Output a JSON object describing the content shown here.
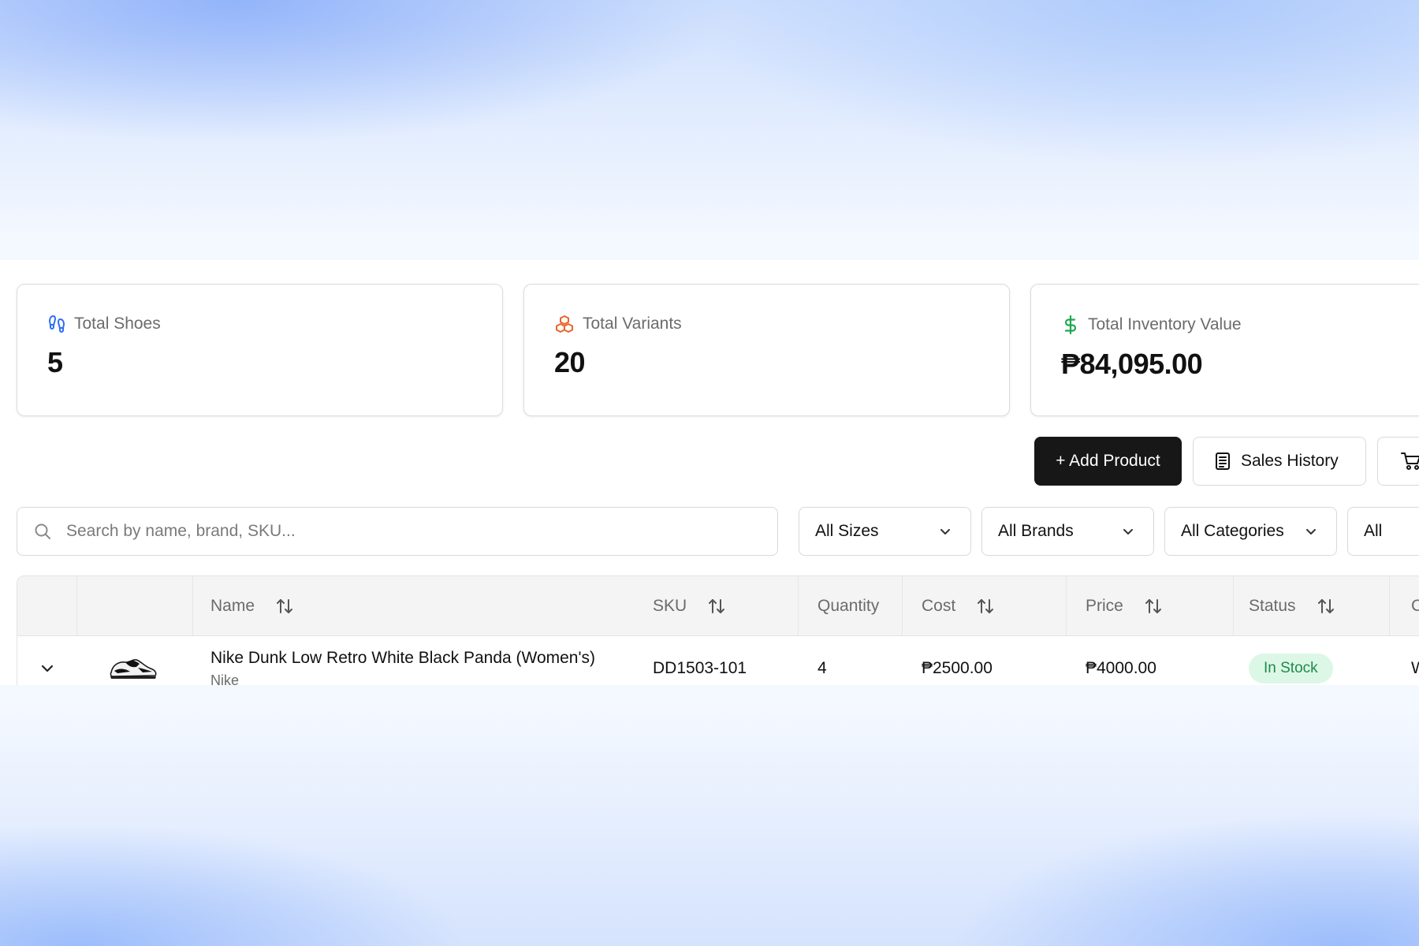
{
  "stats": [
    {
      "label": "Total Shoes",
      "value": "5",
      "icon": "footprints-icon",
      "icon_color": "#2f6df6"
    },
    {
      "label": "Total Variants",
      "value": "20",
      "icon": "boxes-icon",
      "icon_color": "#e8662a"
    },
    {
      "label": "Total Inventory Value",
      "value": "₱84,095.00",
      "icon": "dollar-icon",
      "icon_color": "#1fa64f"
    }
  ],
  "actions": {
    "add_product": "+ Add Product",
    "sales_history": "Sales History",
    "cart_icon": "cart-icon"
  },
  "search": {
    "placeholder": "Search by name, brand, SKU..."
  },
  "filters": {
    "sizes": "All Sizes",
    "brands": "All Brands",
    "categories": "All Categories",
    "status": "All"
  },
  "table": {
    "headers": {
      "name": "Name",
      "sku": "SKU",
      "quantity": "Quantity",
      "cost": "Cost",
      "price": "Price",
      "status": "Status",
      "extra": "C"
    },
    "rows": [
      {
        "name": "Nike Dunk Low Retro White Black Panda (Women's)",
        "brand": "Nike",
        "sku": "DD1503-101",
        "quantity": "4",
        "cost": "₱2500.00",
        "price": "₱4000.00",
        "status": "In Stock",
        "extra": "W"
      }
    ]
  },
  "colors": {
    "primary_button": "#171717",
    "in_stock_bg": "#dcf7e6",
    "in_stock_text": "#1f8a4a"
  }
}
